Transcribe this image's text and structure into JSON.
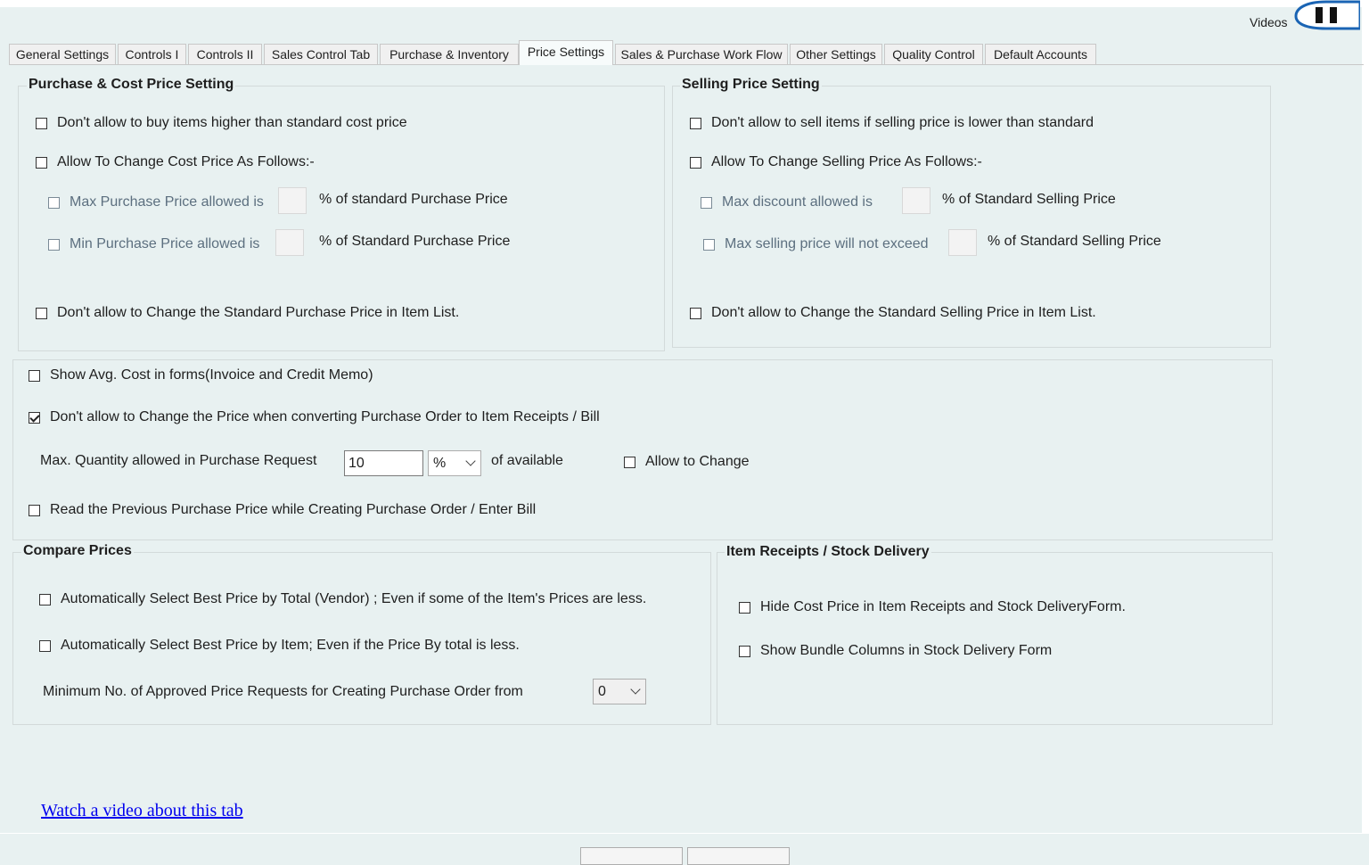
{
  "header": {
    "videos_label": "Videos"
  },
  "tabs": [
    {
      "label": "General Settings"
    },
    {
      "label": "Controls I"
    },
    {
      "label": "Controls II"
    },
    {
      "label": "Sales Control Tab"
    },
    {
      "label": "Purchase & Inventory"
    },
    {
      "label": "Price Settings",
      "active": true
    },
    {
      "label": "Sales & Purchase Work Flow"
    },
    {
      "label": "Other Settings"
    },
    {
      "label": "Quality Control"
    },
    {
      "label": "Default Accounts"
    }
  ],
  "purchase_cost": {
    "title": "Purchase & Cost Price Setting",
    "dont_buy_higher": "Don't allow to buy items higher than standard cost price",
    "allow_change_cost": "Allow To Change Cost Price As Follows:-",
    "max_purchase_label": "Max Purchase Price allowed  is",
    "max_purchase_suffix": "% of standard Purchase Price",
    "min_purchase_label": "Min Purchase Price allowed is",
    "min_purchase_suffix": "% of Standard Purchase Price",
    "dont_change_std_purchase": "Don't allow to Change the Standard Purchase Price in Item List."
  },
  "selling_price": {
    "title": "Selling Price Setting",
    "dont_sell_lower": "Don't allow to sell items if selling price is lower than standard",
    "allow_change_selling": "Allow To Change Selling Price As Follows:-",
    "max_discount_label": "Max discount allowed is",
    "max_discount_suffix": "% of Standard Selling Price",
    "max_selling_label": "Max selling price will not exceed",
    "max_selling_suffix": "% of Standard Selling Price",
    "dont_change_std_selling": "Don't allow to Change the Standard Selling Price in Item List."
  },
  "general": {
    "show_avg_cost": "Show Avg. Cost in forms(Invoice and Credit Memo)",
    "dont_change_price_po": "Don't allow to Change the Price when converting Purchase Order to Item Receipts / Bill",
    "max_qty_label": "Max. Quantity allowed in Purchase Request",
    "max_qty_value": "10",
    "max_qty_unit": "%",
    "of_available": "of available",
    "allow_to_change": "Allow to Change",
    "read_prev_price": "Read the Previous Purchase Price while Creating Purchase Order / Enter Bill"
  },
  "compare_prices": {
    "title": "Compare Prices",
    "best_by_total": "Automatically Select Best Price by Total (Vendor) ; Even if some of the Item's Prices are less.",
    "best_by_item": "Automatically Select Best Price by Item; Even if the Price By total is less.",
    "min_approved_label": "Minimum No. of Approved Price Requests for Creating Purchase Order from",
    "min_approved_value": "0"
  },
  "item_receipts": {
    "title": "Item Receipts / Stock Delivery",
    "hide_cost": "Hide Cost Price in Item Receipts and Stock DeliveryForm.",
    "show_bundle": "Show Bundle Columns in Stock Delivery Form"
  },
  "footer": {
    "video_link": "Watch a video about this tab"
  }
}
